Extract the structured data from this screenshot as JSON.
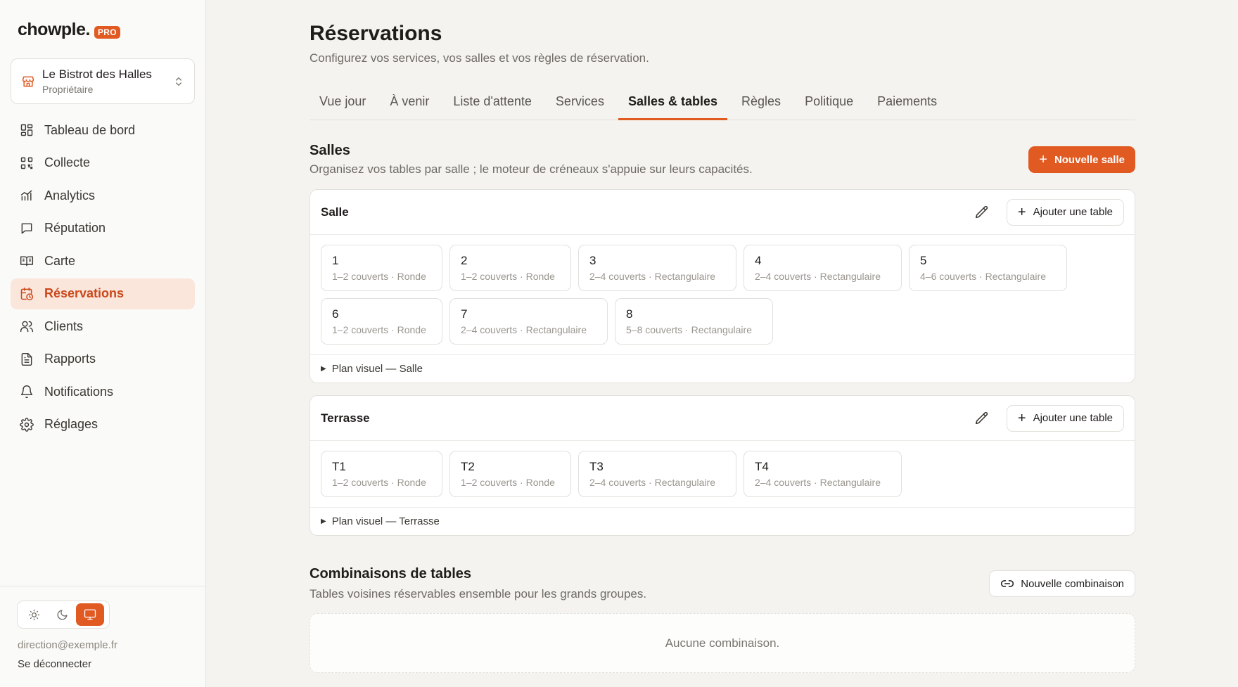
{
  "brand": {
    "name": "chowple.",
    "badge": "PRO"
  },
  "venue": {
    "name": "Le Bistrot des Halles",
    "role": "Propriétaire"
  },
  "nav": [
    {
      "label": "Tableau de bord",
      "icon": "dashboard-icon"
    },
    {
      "label": "Collecte",
      "icon": "qr-code-icon"
    },
    {
      "label": "Analytics",
      "icon": "analytics-icon"
    },
    {
      "label": "Réputation",
      "icon": "review-icon"
    },
    {
      "label": "Carte",
      "icon": "menu-book-icon"
    },
    {
      "label": "Réservations",
      "icon": "calendar-clock-icon",
      "active": true
    },
    {
      "label": "Clients",
      "icon": "users-icon"
    },
    {
      "label": "Rapports",
      "icon": "report-icon"
    },
    {
      "label": "Notifications",
      "icon": "bell-icon"
    },
    {
      "label": "Réglages",
      "icon": "gear-icon"
    }
  ],
  "footer": {
    "email": "direction@exemple.fr",
    "logout": "Se déconnecter",
    "theme_active": "system"
  },
  "page": {
    "title": "Réservations",
    "subtitle": "Configurez vos services, vos salles et vos règles de réservation."
  },
  "tabs": [
    {
      "label": "Vue jour"
    },
    {
      "label": "À venir"
    },
    {
      "label": "Liste d'attente"
    },
    {
      "label": "Services"
    },
    {
      "label": "Salles & tables",
      "active": true
    },
    {
      "label": "Règles"
    },
    {
      "label": "Politique"
    },
    {
      "label": "Paiements"
    }
  ],
  "salles": {
    "title": "Salles",
    "subtitle": "Organisez vos tables par salle ; le moteur de créneaux s'appuie sur leurs capacités.",
    "new_button": "Nouvelle salle",
    "add_table_label": "Ajouter une table",
    "rooms": [
      {
        "name": "Salle",
        "plan_label": "Plan visuel — Salle",
        "tables": [
          {
            "name": "1",
            "meta": "1–2 couverts · Ronde"
          },
          {
            "name": "2",
            "meta": "1–2 couverts · Ronde"
          },
          {
            "name": "3",
            "meta": "2–4 couverts · Rectangulaire"
          },
          {
            "name": "4",
            "meta": "2–4 couverts · Rectangulaire"
          },
          {
            "name": "5",
            "meta": "4–6 couverts · Rectangulaire"
          },
          {
            "name": "6",
            "meta": "1–2 couverts · Ronde"
          },
          {
            "name": "7",
            "meta": "2–4 couverts · Rectangulaire"
          },
          {
            "name": "8",
            "meta": "5–8 couverts · Rectangulaire"
          }
        ]
      },
      {
        "name": "Terrasse",
        "plan_label": "Plan visuel — Terrasse",
        "tables": [
          {
            "name": "T1",
            "meta": "1–2 couverts · Ronde"
          },
          {
            "name": "T2",
            "meta": "1–2 couverts · Ronde"
          },
          {
            "name": "T3",
            "meta": "2–4 couverts · Rectangulaire"
          },
          {
            "name": "T4",
            "meta": "2–4 couverts · Rectangulaire"
          }
        ]
      }
    ]
  },
  "combinaisons": {
    "title": "Combinaisons de tables",
    "subtitle": "Tables voisines réservables ensemble pour les grands groupes.",
    "new_button": "Nouvelle combinaison",
    "empty": "Aucune combinaison."
  },
  "colors": {
    "accent": "#e05a22",
    "accent_soft": "#fbe6dc",
    "background": "#f4f3f0"
  }
}
